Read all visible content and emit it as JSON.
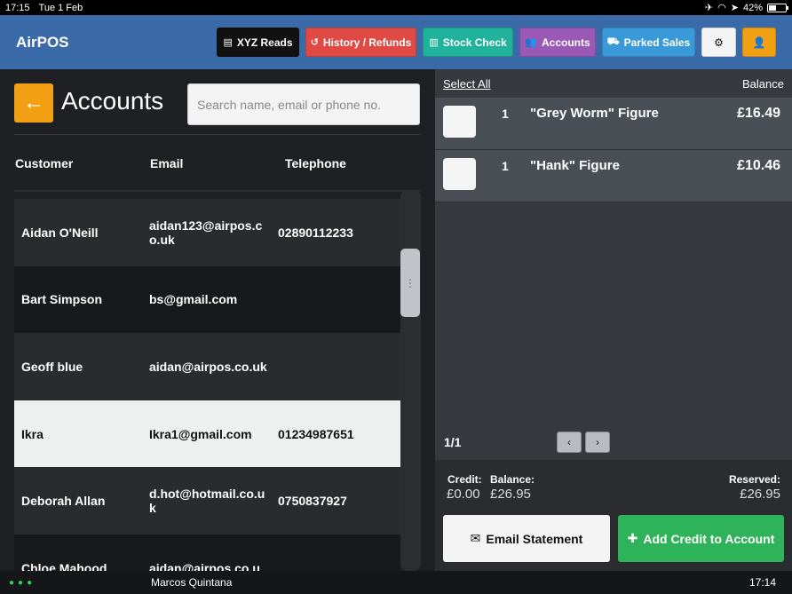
{
  "status_bar": {
    "time": "17:15",
    "date": "Tue 1 Feb",
    "battery": "42%",
    "battery_level": 0.42
  },
  "header": {
    "brand": "AirPOS",
    "buttons": [
      {
        "label": "XYZ Reads",
        "icon": "list-icon",
        "color": "#111111"
      },
      {
        "label": "History / Refunds",
        "icon": "history-icon",
        "color": "#e04a44"
      },
      {
        "label": "Stock Check",
        "icon": "barcode-icon",
        "color": "#20b29a"
      },
      {
        "label": "Accounts",
        "icon": "users-icon",
        "color": "#9b59b6"
      },
      {
        "label": "Parked Sales",
        "icon": "car-icon",
        "color": "#3a9ad9"
      }
    ],
    "settings_icon": "gear-icon",
    "user_icon": "user-icon",
    "settings_bg": "#f4f4f4",
    "user_bg": "#f0a012"
  },
  "accounts": {
    "title": "Accounts",
    "back_icon": "arrow-left-icon",
    "search_placeholder": "Search name, email or phone no.",
    "columns": [
      "Customer",
      "Email",
      "Telephone"
    ],
    "rows": [
      {
        "customer": "Aidan O'Neill",
        "email": "aidan123@airpos.co.uk",
        "telephone": "02890112233"
      },
      {
        "customer": "Bart Simpson",
        "email": "bs@gmail.com",
        "telephone": ""
      },
      {
        "customer": "Geoff blue",
        "email": "aidan@airpos.co.uk",
        "telephone": ""
      },
      {
        "customer": "Ikra",
        "email": "Ikra1@gmail.com",
        "telephone": "01234987651",
        "selected": true
      },
      {
        "customer": "Deborah Allan",
        "email": "d.hot@hotmail.co.uk",
        "telephone": "0750837927"
      },
      {
        "customer": "Chloe Mahood",
        "email": "aidan@airpos.co.u",
        "telephone": ""
      }
    ]
  },
  "sale_panel": {
    "select_all": "Select All",
    "balance_label": "Balance",
    "items": [
      {
        "qty": "1",
        "name": "\"Grey Worm\" Figure",
        "price": "£16.49"
      },
      {
        "qty": "1",
        "name": "\"Hank\" Figure",
        "price": "£10.46"
      }
    ],
    "page": "1/1",
    "credit_label": "Credit:",
    "credit_value": "£0.00",
    "balance_total_label": "Balance:",
    "balance_total_value": "£26.95",
    "reserved_label": "Reserved:",
    "reserved_value": "£26.95",
    "email_button": "Email Statement",
    "email_icon": "envelope-icon",
    "credit_button": "Add Credit to Account",
    "credit_icon": "plus-icon"
  },
  "footer": {
    "user": "Marcos Quintana",
    "time": "17:14"
  }
}
